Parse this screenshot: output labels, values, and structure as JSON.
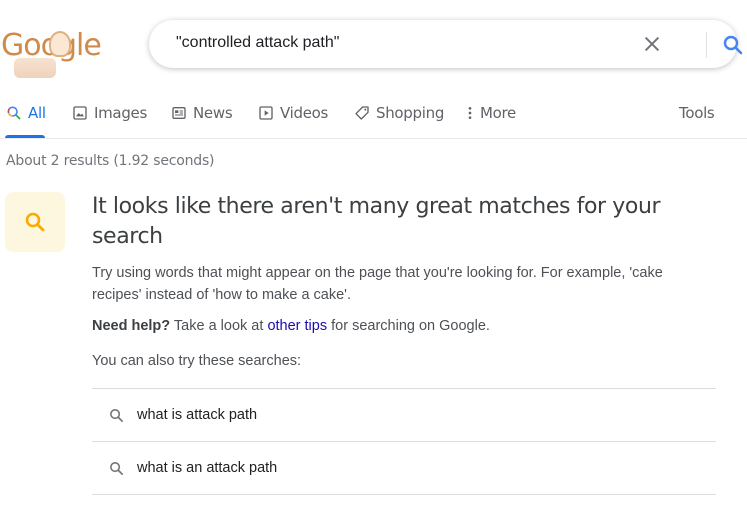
{
  "logo": {
    "text": "Google",
    "doodle": "cake-doodle"
  },
  "search": {
    "query": "\"controlled attack path\"",
    "clear_icon": "close-icon",
    "search_icon": "search-icon",
    "accent_color": "#1a73e8"
  },
  "tabs": [
    {
      "label": "All",
      "icon": "search-icon",
      "active": true
    },
    {
      "label": "Images",
      "icon": "image-icon"
    },
    {
      "label": "News",
      "icon": "news-icon"
    },
    {
      "label": "Videos",
      "icon": "play-icon"
    },
    {
      "label": "Shopping",
      "icon": "tag-icon"
    },
    {
      "label": "More",
      "icon": "more-vert-icon"
    }
  ],
  "tools_label": "Tools",
  "result_stats": "About 2 results (1.92 seconds)",
  "hint": {
    "title": "It looks like there aren't many great matches for your search",
    "body": "Try using words that might appear on the page that you're looking for. For example, 'cake recipes' instead of 'how to make a cake'.",
    "help_bold": "Need help?",
    "help_pre": " Take a look at ",
    "help_link": "other tips",
    "help_post": " for searching on Google.",
    "also_try": "You can also try these searches:",
    "icon_color": "#f9ab00",
    "icon_bg": "#fef7e0"
  },
  "suggestions": [
    {
      "text": "what is attack path"
    },
    {
      "text": "what is an attack path"
    }
  ]
}
